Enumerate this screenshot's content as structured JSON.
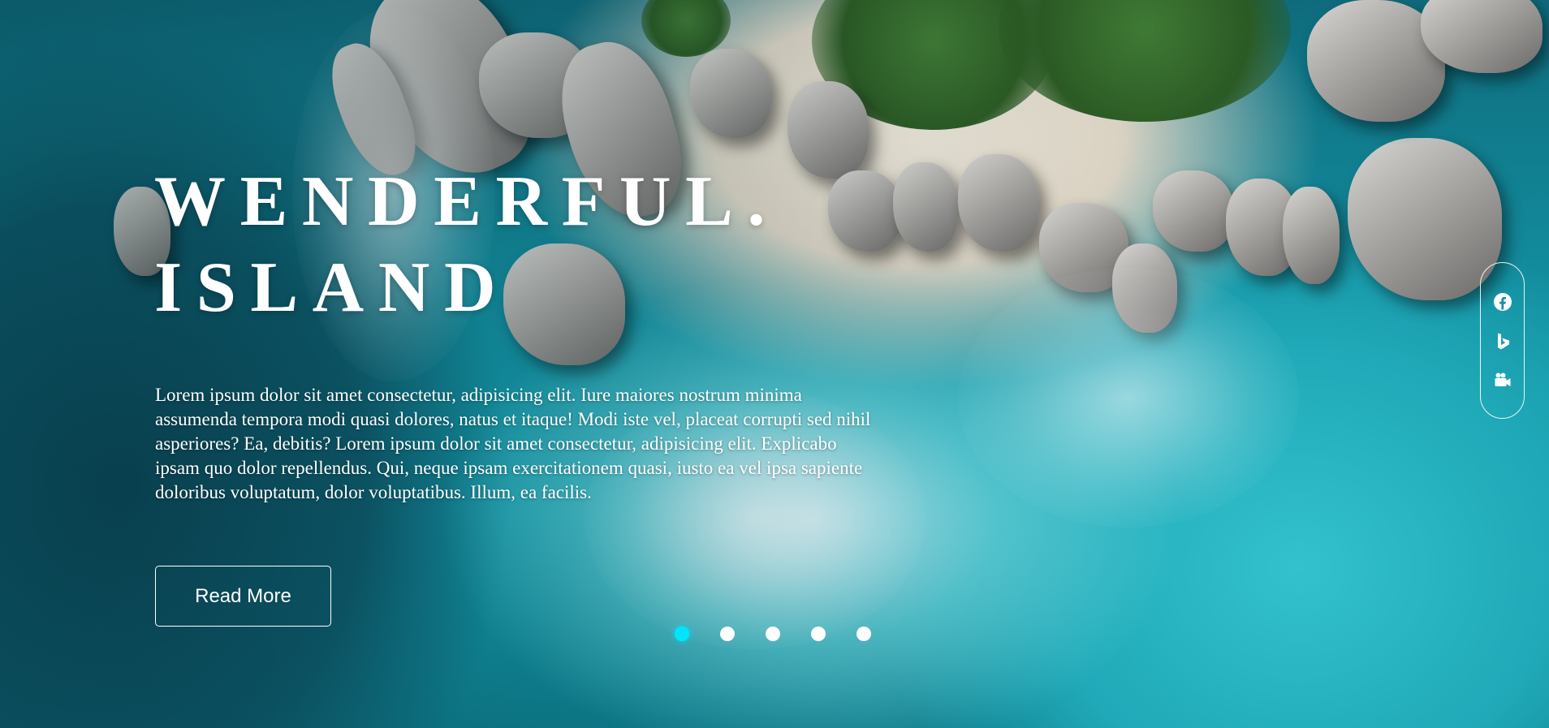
{
  "hero": {
    "title_line1": "WENDERFUL.",
    "title_line2": "ISLAND",
    "description": "Lorem ipsum dolor sit amet consectetur, adipisicing elit. Iure maiores nostrum minima assumenda tempora modi quasi dolores, natus et itaque! Modi iste vel, placeat corrupti sed nihil asperiores? Ea, debitis? Lorem ipsum dolor sit amet consectetur, adipisicing elit. Explicabo ipsam quo dolor repellendus. Qui, neque ipsam exercitationem quasi, iusto ea vel ipsa sapiente doloribus voluptatum, dolor voluptatibus. Illum, ea facilis.",
    "button_label": "Read More"
  },
  "slider": {
    "count": 5,
    "active_index": 0,
    "active_color": "#00e5ff",
    "inactive_color": "#ffffff"
  },
  "social": {
    "icons": [
      "facebook-icon",
      "bing-icon",
      "video-camera-icon"
    ]
  },
  "colors": {
    "text": "#ffffff",
    "accent": "#00e5ff"
  }
}
